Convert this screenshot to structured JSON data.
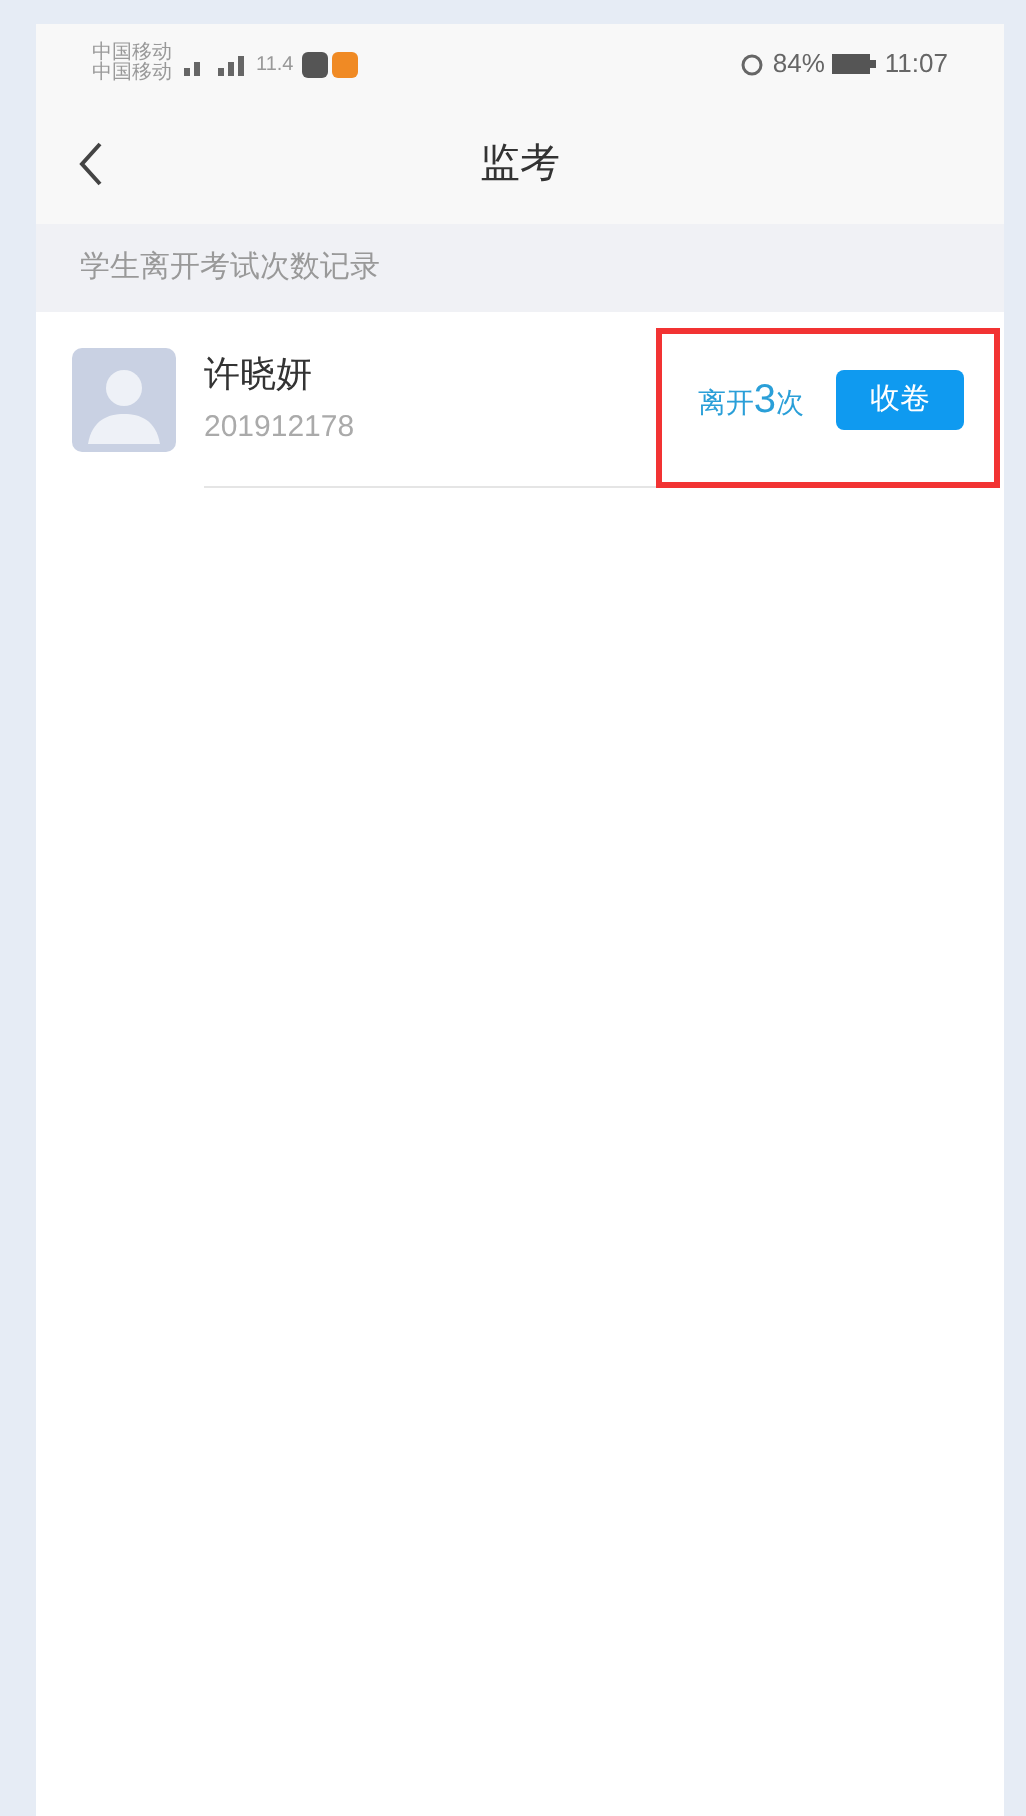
{
  "status_bar": {
    "carriers": [
      "中国移动",
      "中国移动"
    ],
    "speed": "11.4",
    "battery": "84%",
    "time": "11:07"
  },
  "nav": {
    "title": "监考"
  },
  "section": {
    "title": "学生离开考试次数记录"
  },
  "students": [
    {
      "name": "许晓妍",
      "id": "201912178",
      "leave_prefix": "离开",
      "leave_count": "3",
      "leave_suffix": "次",
      "action": "收卷",
      "highlighted": true
    }
  ]
}
